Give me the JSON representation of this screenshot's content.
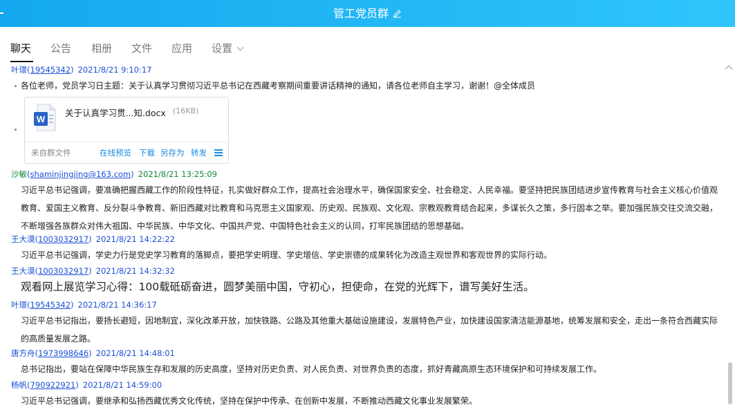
{
  "window": {
    "title": "管工党员群"
  },
  "tabs": [
    "聊天",
    "公告",
    "相册",
    "文件",
    "应用",
    "设置"
  ],
  "messages": [
    {
      "name": "叶璟",
      "qq": "19545342",
      "time": "2021/8/21 9:10:17",
      "text": "各位老师，党员学习日主题：关于认真学习贯彻习近平总书记在西藏考察期间重要讲话精神的通知，请各位老师自主学习，谢谢！@全体成员"
    },
    {
      "name": "沙敏",
      "qq": "shaminjingjing@163.com",
      "time": "2021/8/21 13:25:09",
      "text": "习近平总书记强调，要准确把握西藏工作的阶段性特征，扎实做好群众工作，提高社会治理水平，确保国家安全、社会稳定、人民幸福。要坚持把民族团结进步宣传教育与社会主义核心价值观教育、爱国主义教育、反分裂斗争教育、新旧西藏对比教育和马克思主义国家观、历史观、民族观、文化观、宗教观教育结合起来，多谋长久之策，多行固本之举。要加强民族交往交流交融，不断增强各族群众对伟大祖国、中华民族、中华文化、中国共产党、中国特色社会主义的认同，打牢民族团结的思想基础。"
    },
    {
      "name": "王大漠",
      "qq": "1003032917",
      "time": "2021/8/21 14:22:22",
      "text": "习近平总书记强调，学史力行是党史学习教育的落脚点，要把学史明理、学史增信、学史崇德的成果转化为改造主观世界和客观世界的实际行动。"
    },
    {
      "name": "王大漠",
      "qq": "1003032917",
      "time": "2021/8/21 14:32:32",
      "text": "观看网上展览学习心得：100载砥砺奋进，圆梦美丽中国，守初心，担使命，在党的光辉下，谱写美好生活。"
    },
    {
      "name": "叶璟",
      "qq": "19545342",
      "time": "2021/8/21 14:36:17",
      "text": "习近平总书记指出，要扬长避短，因地制宜，深化改革开放，加快铁路、公路及其他重大基础设施建设，发展特色产业，加快建设国家清洁能源基地，统筹发展和安全，走出一条符合西藏实际的高质量发展之路。"
    },
    {
      "name": "唐方舟",
      "qq": "1973998646",
      "time": "2021/8/21 14:48:01",
      "text": "总书记指出，要站在保障中华民族生存和发展的历史高度，坚持对历史负责、对人民负责、对世界负责的态度，抓好青藏高原生态环境保护和可持续发展工作。"
    },
    {
      "name": "杨帆",
      "qq": "790922921",
      "time": "2021/8/21 14:59:00",
      "text": "习近平总书记强调，要继承和弘扬西藏优秀文化传统，坚持在保护中传承、在创新中发展，不断推动西藏文化事业发展繁荣。"
    }
  ],
  "file": {
    "name": "关于认真学习贯...知.docx",
    "size": "(16KB)",
    "from": "来自群文件",
    "actions": [
      "在线预览",
      "下载",
      "另存为",
      "转发"
    ]
  },
  "colors": {
    "title_bar": "#15a8ee",
    "link_blue": "#1a4fd6",
    "action_blue": "#1a8be0",
    "name_green": "#12883a"
  }
}
